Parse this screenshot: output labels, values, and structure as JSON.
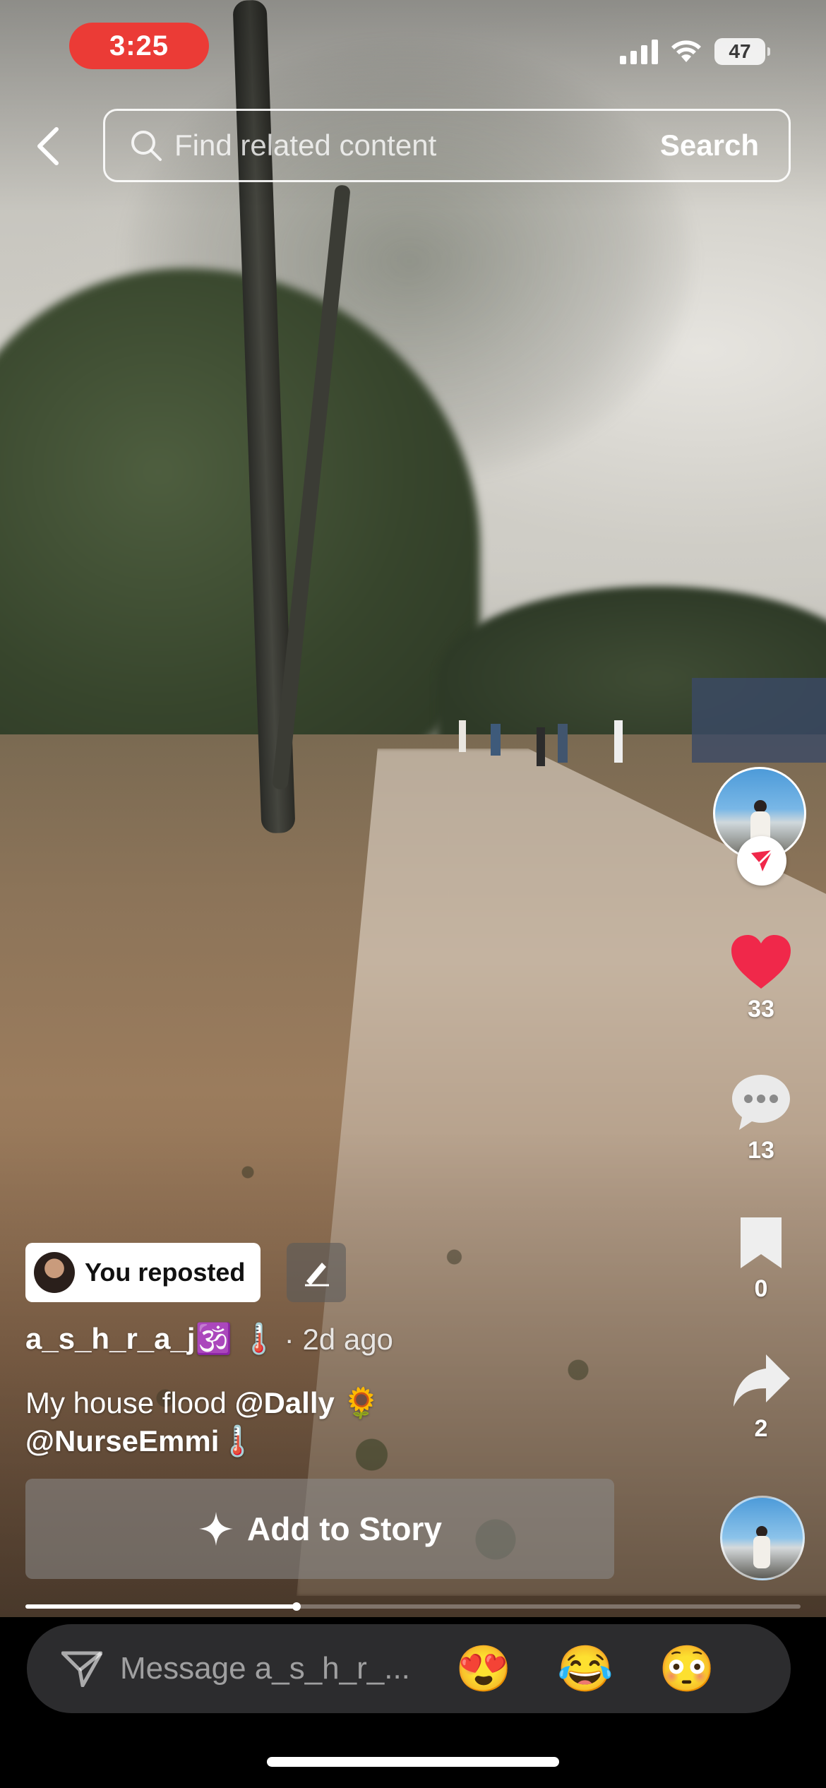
{
  "status_bar": {
    "time": "3:25",
    "battery": "47"
  },
  "search": {
    "placeholder": "Find related content",
    "button_label": "Search"
  },
  "actions": {
    "likes": "33",
    "comments": "13",
    "saves": "0",
    "shares": "2"
  },
  "post": {
    "repost_label": "You reposted",
    "author": "a_s_h_r_a_j🕉️ 🌡️",
    "time_ago": "· 2d ago",
    "caption_text": "My house flood ",
    "mention_1": "@Dally",
    "emoji_1": " 🌻",
    "mention_2": "@NurseEmmi",
    "emoji_2": "🌡️",
    "add_story_label": "Add to Story",
    "progress": 0.35
  },
  "message_bar": {
    "placeholder": "Message a_s_h_r_...",
    "quick_emojis": [
      "😍",
      "😂",
      "😳"
    ]
  },
  "colors": {
    "like": "#f0284a",
    "time_pill": "#eb3b36",
    "repost_badge": "#f0284a"
  }
}
